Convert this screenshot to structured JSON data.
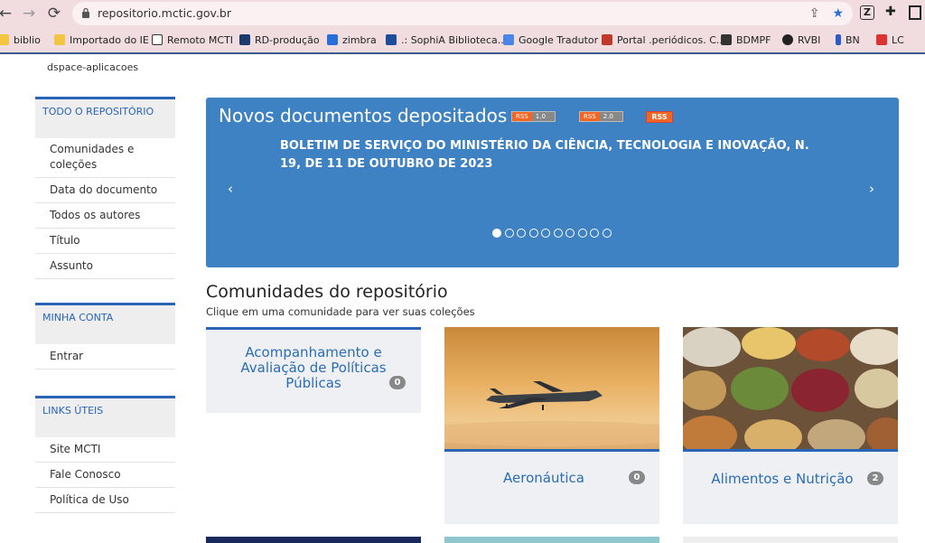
{
  "browser": {
    "url": "repositorio.mctic.gov.br",
    "bookmarks": [
      "biblio",
      "Importado do IE",
      "Remoto MCTI",
      "RD-produção",
      "zimbra",
      ".: SophiA Biblioteca...",
      "Google Tradutor",
      "Portal .periódicos. C...",
      "BDMPF",
      "RVBI",
      "BN",
      "LC"
    ]
  },
  "site": {
    "title": "dspace-aplicacoes"
  },
  "sidebar": {
    "all_repo": {
      "heading": "TODO O REPOSITÓRIO",
      "items": [
        "Comunidades e coleções",
        "Data do documento",
        "Todos os autores",
        "Título",
        "Assunto"
      ]
    },
    "account": {
      "heading": "MINHA CONTA",
      "items": [
        "Entrar"
      ]
    },
    "links": {
      "heading": "LINKS ÚTEIS",
      "items": [
        "Site MCTI",
        "Fale Conosco",
        "Política de Uso"
      ]
    }
  },
  "carousel": {
    "title": "Novos documentos depositados",
    "rss": [
      {
        "l": "RSS",
        "r": "1.0"
      },
      {
        "l": "RSS",
        "r": "2.0"
      }
    ],
    "rss_badge": "RSS",
    "item": "BOLETIM DE SERVIÇO DO MINISTÉRIO DA CIÊNCIA, TECNOLOGIA E INOVAÇÃO, N. 19, DE 11 DE OUTUBRO DE 2023",
    "prev": "‹",
    "next": "›",
    "slides": 10,
    "active": 0
  },
  "communities": {
    "title": "Comunidades do repositório",
    "subtitle": "Clique em uma comunidade para ver suas coleções",
    "cards": [
      {
        "name": "Acompanhamento e Avaliação de Políticas Públicas",
        "count": "0"
      },
      {
        "name": "Aeronáutica",
        "count": "0"
      },
      {
        "name": "Alimentos e Nutrição",
        "count": "2"
      }
    ]
  },
  "colors": {
    "accent": "#2964b7",
    "carousel": "#3f82c4",
    "rss": "#f26522"
  }
}
